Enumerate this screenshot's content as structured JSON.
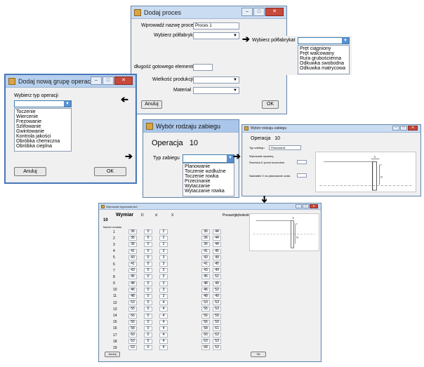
{
  "dodaj_proces": {
    "title": "Dodaj proces",
    "wprowadz_label": "Wprowadź nazwę procesu:",
    "proces_value": "Proces 1",
    "wybierz_polfabrykat_label": "Wybierz półfabrykat",
    "dlugosc_label": "długość gotowego elementu",
    "wielkosc_label": "Wielkość produkcji",
    "material_label": "Materiał",
    "cancel_label": "Anuluj",
    "ok_label": "OK",
    "popup_label": "Wybierz półfabrykat",
    "popup_options": [
      "Pręt ciągniony",
      "Pręt walcowany",
      "Rura grubościenna",
      "Odkuwka swobodna",
      "Odkuwka matrycowa"
    ]
  },
  "nowa_grupa": {
    "title": "Dodaj nową grupę operacji",
    "wybierz_label": "Wybierz typ operacji",
    "options": [
      "Toczenie",
      "Wiercenie",
      "Frezowanie",
      "Szlifowanie",
      "Gwintowanie",
      "Kontrola jakości",
      "Obróbka chemiczna",
      "Obróbka cieplna"
    ],
    "cancel_label": "Anuluj",
    "ok_label": "OK"
  },
  "wybor_rodzaju": {
    "title": "Wybór rodzaju zabiegu",
    "operacja_label": "Operacja",
    "operacja_value": "10",
    "typ_label": "Typ zabiegu",
    "options": [
      "Planowanie",
      "Toczenie wzdłużne",
      "Toczenie rowka",
      "Przecinanie",
      "Wytaczanie",
      "Wytaczanie rowka"
    ]
  },
  "wybor_small": {
    "title": "Wybór rodzaju zabiegu",
    "operacja_label": "Operacja",
    "operacja_value": "10",
    "typ_label": "Typ zabiegu",
    "typ_value": "Planowanie",
    "wprowadz_label": "Wprowadź wymiary",
    "srednica_label": "Średnica D przed toczeniem",
    "naddatek_label": "Naddatek X na planowanie czoła",
    "drawing_labels": {
      "a": "a",
      "f": "f",
      "d": "D"
    }
  },
  "tabela": {
    "title": "Wprowadź tryprowdkości",
    "wymiar_label": "Wymiar",
    "op_value": "10",
    "col_D": "D",
    "col_d": "d",
    "col_X": "X",
    "posuw_label": "Posuw/głębokość",
    "numer_label": "Numer modułu",
    "drawing_labels": {
      "a": "a",
      "f": "f",
      "d": "D"
    },
    "rows": [
      {
        "n": "1",
        "D": "36",
        "d": "0",
        "X": "2",
        "p1": "36",
        "p2": "44"
      },
      {
        "n": "2",
        "D": "36",
        "d": "0",
        "X": "2",
        "p1": "36",
        "p2": "44"
      },
      {
        "n": "3",
        "D": "36",
        "d": "0",
        "X": "2",
        "p1": "36",
        "p2": "44"
      },
      {
        "n": "4",
        "D": "41",
        "d": "0",
        "X": "3",
        "p1": "41",
        "p2": "45"
      },
      {
        "n": "5",
        "D": "43",
        "d": "0",
        "X": "3",
        "p1": "43",
        "p2": "49"
      },
      {
        "n": "6",
        "D": "41",
        "d": "0",
        "X": "3",
        "p1": "41",
        "p2": "45"
      },
      {
        "n": "7",
        "D": "43",
        "d": "0",
        "X": "3",
        "p1": "43",
        "p2": "49"
      },
      {
        "n": "8",
        "D": "45",
        "d": "0",
        "X": "3",
        "p1": "45",
        "p2": "52"
      },
      {
        "n": "9",
        "D": "48",
        "d": "0",
        "X": "3",
        "p1": "48",
        "p2": "49"
      },
      {
        "n": "10",
        "D": "46",
        "d": "0",
        "X": "3",
        "p1": "46",
        "p2": "52"
      },
      {
        "n": "11",
        "D": "48",
        "d": "0",
        "X": "3",
        "p1": "48",
        "p2": "49"
      },
      {
        "n": "12",
        "D": "53",
        "d": "0",
        "X": "4",
        "p1": "53",
        "p2": "53"
      },
      {
        "n": "13",
        "D": "55",
        "d": "0",
        "X": "4",
        "p1": "55",
        "p2": "53"
      },
      {
        "n": "14",
        "D": "56",
        "d": "0",
        "X": "4",
        "p1": "56",
        "p2": "59"
      },
      {
        "n": "15",
        "D": "56",
        "d": "0",
        "X": "4",
        "p1": "56",
        "p2": "59"
      },
      {
        "n": "16",
        "D": "58",
        "d": "0",
        "X": "4",
        "p1": "58",
        "p2": "61"
      },
      {
        "n": "17",
        "D": "60",
        "d": "0",
        "X": "4",
        "p1": "60",
        "p2": "63"
      },
      {
        "n": "18",
        "D": "63",
        "d": "0",
        "X": "4",
        "p1": "63",
        "p2": "53"
      },
      {
        "n": "19",
        "D": "63",
        "d": "0",
        "X": "4",
        "p1": "68",
        "p2": "53"
      }
    ],
    "cancel_label": "Anuluj",
    "ok_label": "Ok"
  }
}
